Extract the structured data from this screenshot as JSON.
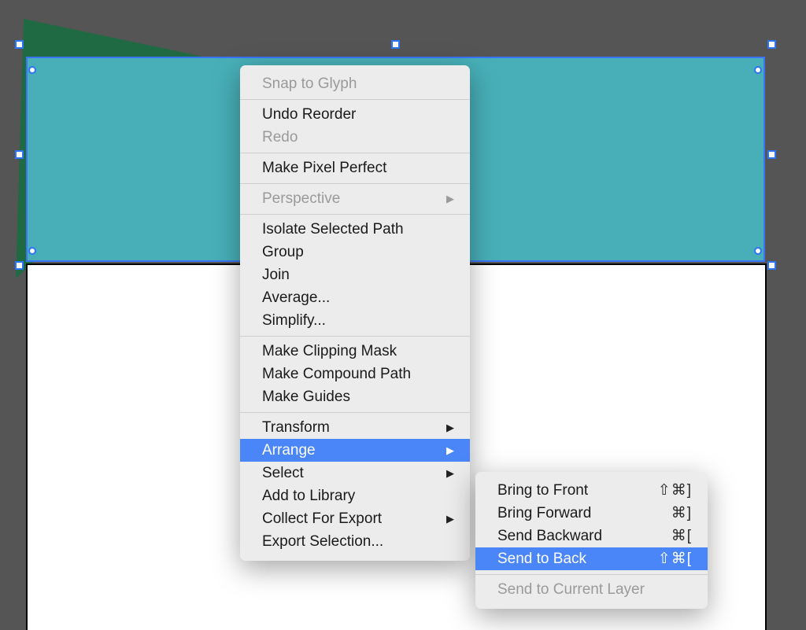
{
  "mainMenu": {
    "groups": [
      [
        {
          "label": "Snap to Glyph",
          "disabled": true
        }
      ],
      [
        {
          "label": "Undo Reorder"
        },
        {
          "label": "Redo",
          "disabled": true
        }
      ],
      [
        {
          "label": "Make Pixel Perfect"
        }
      ],
      [
        {
          "label": "Perspective",
          "disabled": true,
          "submenu": true
        }
      ],
      [
        {
          "label": "Isolate Selected Path"
        },
        {
          "label": "Group"
        },
        {
          "label": "Join"
        },
        {
          "label": "Average..."
        },
        {
          "label": "Simplify..."
        }
      ],
      [
        {
          "label": "Make Clipping Mask"
        },
        {
          "label": "Make Compound Path"
        },
        {
          "label": "Make Guides"
        }
      ],
      [
        {
          "label": "Transform",
          "submenu": true
        },
        {
          "label": "Arrange",
          "submenu": true,
          "highlight": true
        },
        {
          "label": "Select",
          "submenu": true
        },
        {
          "label": "Add to Library"
        },
        {
          "label": "Collect For Export",
          "submenu": true
        },
        {
          "label": "Export Selection..."
        }
      ]
    ]
  },
  "subMenu": {
    "groups": [
      [
        {
          "label": "Bring to Front",
          "shortcut": "⇧⌘]"
        },
        {
          "label": "Bring Forward",
          "shortcut": "⌘]"
        },
        {
          "label": "Send Backward",
          "shortcut": "⌘["
        },
        {
          "label": "Send to Back",
          "shortcut": "⇧⌘[",
          "highlight": true
        }
      ],
      [
        {
          "label": "Send to Current Layer",
          "disabled": true
        }
      ]
    ]
  }
}
